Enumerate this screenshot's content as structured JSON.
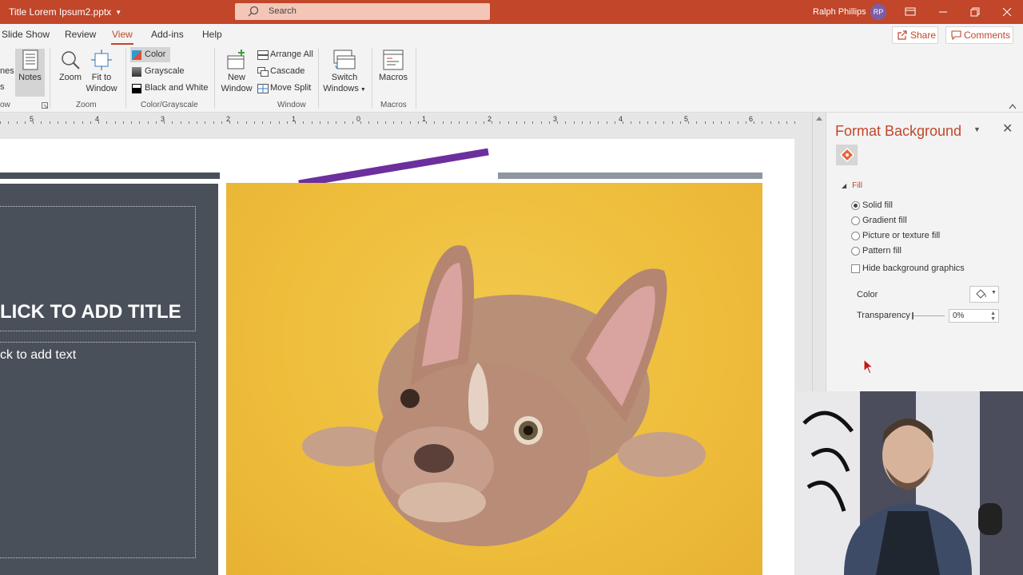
{
  "window": {
    "filename": "Title Lorem Ipsum2.pptx",
    "search_placeholder": "Search",
    "user_name": "Ralph Phillips",
    "user_initials": "RP"
  },
  "tabs": [
    {
      "label": "Slide Show"
    },
    {
      "label": "Review"
    },
    {
      "label": "View",
      "active": true
    },
    {
      "label": "Add-ins"
    },
    {
      "label": "Help"
    }
  ],
  "share_label": "Share",
  "comments_label": "Comments",
  "ribbon": {
    "partial_left_1": "nes",
    "partial_left_2": "s",
    "partial_group": "ow",
    "notes": "Notes",
    "zoom": "Zoom",
    "fit_to_window_1": "Fit to",
    "fit_to_window_2": "Window",
    "zoom_group": "Zoom",
    "color": "Color",
    "grayscale": "Grayscale",
    "black_and_white": "Black and White",
    "color_group": "Color/Grayscale",
    "new_window_1": "New",
    "new_window_2": "Window",
    "arrange_all": "Arrange All",
    "cascade": "Cascade",
    "move_split": "Move Split",
    "switch_windows_1": "Switch",
    "switch_windows_2": "Windows",
    "window_group": "Window",
    "macros": "Macros",
    "macros_group": "Macros"
  },
  "ruler": {
    "labels": [
      "5",
      "4",
      "3",
      "2",
      "1",
      "0",
      "1",
      "2",
      "3",
      "4",
      "5",
      "6"
    ]
  },
  "slide": {
    "title_placeholder": "LICK TO ADD TITLE",
    "body_placeholder": "ck to add text"
  },
  "format_pane": {
    "title": "Format Background",
    "fill_section": "Fill",
    "options": [
      "Solid fill",
      "Gradient fill",
      "Picture or texture fill",
      "Pattern fill"
    ],
    "selected_option": "Solid fill",
    "hide_background": "Hide background graphics",
    "color_label": "Color",
    "transparency_label": "Transparency",
    "transparency_value": "0%"
  },
  "colors": {
    "accent": "#c1462a",
    "slide_dark": "#4a505a",
    "slide_gray_bar": "#8f96a0",
    "purple_line": "#6b2f9e",
    "photo_bg": "#eebd3a"
  }
}
